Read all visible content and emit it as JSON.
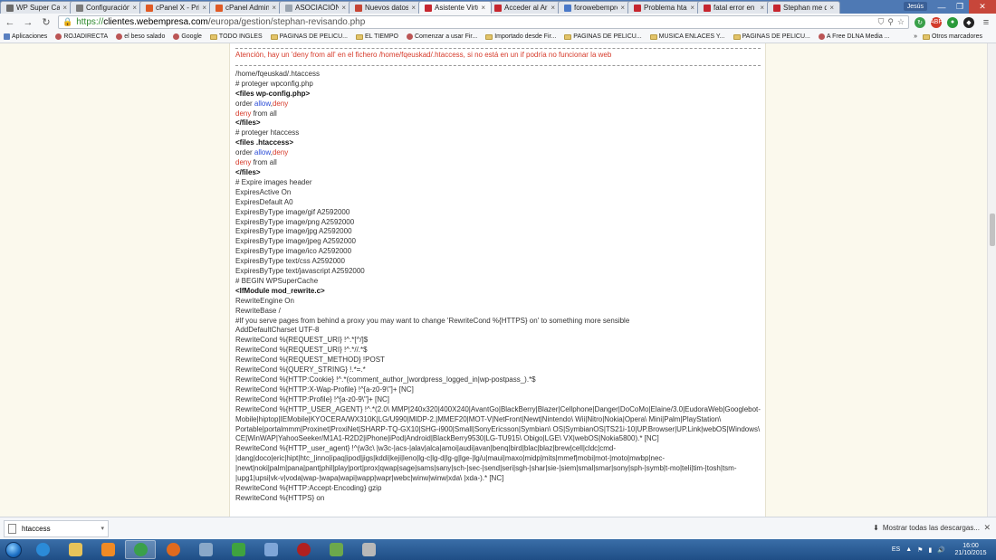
{
  "browser": {
    "tabs": [
      {
        "title": "WP Super Cache",
        "color": "#6b6b6b",
        "active": false
      },
      {
        "title": "Configuración",
        "color": "#7b7b7b",
        "active": false
      },
      {
        "title": "cPanel X - Princ",
        "color": "#e05a25",
        "active": false
      },
      {
        "title": "cPanel Administ",
        "color": "#e05a25",
        "active": false
      },
      {
        "title": "ASOCIACIÓN D.",
        "color": "#9aa4b0",
        "active": false
      },
      {
        "title": "Nuevos datos de",
        "color": "#c64534",
        "active": false
      },
      {
        "title": "Asistente Virtual",
        "color": "#c6262e",
        "active": true
      },
      {
        "title": "Acceder al Area",
        "color": "#c6262e",
        "active": false
      },
      {
        "title": "forowebempresa",
        "color": "#4a79c8",
        "active": false
      },
      {
        "title": "Problema htacce",
        "color": "#c6262e",
        "active": false
      },
      {
        "title": "fatal error en la",
        "color": "#c6262e",
        "active": false
      },
      {
        "title": "Stephan me da e",
        "color": "#c6262e",
        "active": false
      }
    ],
    "user_badge": "Jesús",
    "url_scheme": "https://",
    "url_host": "clientes.webempresa.com",
    "url_path": "/europa/gestion/stephan-revisando.php",
    "bookmarks": [
      {
        "label": "Aplicaciones",
        "kind": "apps"
      },
      {
        "label": "ROJADIRECTA",
        "kind": "site"
      },
      {
        "label": "el beso salado",
        "kind": "site"
      },
      {
        "label": "Google",
        "kind": "site"
      },
      {
        "label": "TODO INGLES",
        "kind": "folder"
      },
      {
        "label": "PAGINAS DE PELICU...",
        "kind": "folder"
      },
      {
        "label": "EL TIEMPO",
        "kind": "folder"
      },
      {
        "label": "Comenzar a usar Fir...",
        "kind": "site"
      },
      {
        "label": "Importado desde Fir...",
        "kind": "folder"
      },
      {
        "label": "PAGINAS DE PELICU...",
        "kind": "folder"
      },
      {
        "label": "MUSICA ENLACES Y...",
        "kind": "folder"
      },
      {
        "label": "PAGINAS DE PELICU...",
        "kind": "folder"
      },
      {
        "label": "A Free DLNA Media ...",
        "kind": "site"
      }
    ],
    "bookmarks_more": "»",
    "other_bookmarks": "Otros marcadores"
  },
  "page": {
    "warning": "Atención, hay un 'deny from all' en el fichero /home/fqeuskad/.htaccess, si no está en un if podría no funcionar la web",
    "lines": [
      [
        {
          "t": "/home/fqeuskad/.htaccess"
        }
      ],
      [
        {
          "t": "# proteger wpconfig.php"
        }
      ],
      [
        {
          "t": "<files wp-config.php>",
          "s": "b"
        }
      ],
      [
        {
          "t": "order "
        },
        {
          "t": "allow",
          "s": "blue"
        },
        {
          "t": ","
        },
        {
          "t": "deny",
          "s": "red"
        }
      ],
      [
        {
          "t": "deny",
          "s": "red"
        },
        {
          "t": " from all"
        }
      ],
      [
        {
          "t": "</files>",
          "s": "b"
        }
      ],
      [
        {
          "t": "# proteger htaccess"
        }
      ],
      [
        {
          "t": "<files .htaccess>",
          "s": "b"
        }
      ],
      [
        {
          "t": "order "
        },
        {
          "t": "allow",
          "s": "blue"
        },
        {
          "t": ","
        },
        {
          "t": "deny",
          "s": "red"
        }
      ],
      [
        {
          "t": "deny",
          "s": "red"
        },
        {
          "t": " from all"
        }
      ],
      [
        {
          "t": "</files>",
          "s": "b"
        }
      ],
      [
        {
          "t": "# Expire images header"
        }
      ],
      [
        {
          "t": "ExpiresActive On"
        }
      ],
      [
        {
          "t": "ExpiresDefault A0"
        }
      ],
      [
        {
          "t": "ExpiresByType image/gif A2592000"
        }
      ],
      [
        {
          "t": "ExpiresByType image/png A2592000"
        }
      ],
      [
        {
          "t": "ExpiresByType image/jpg A2592000"
        }
      ],
      [
        {
          "t": "ExpiresByType image/jpeg A2592000"
        }
      ],
      [
        {
          "t": "ExpiresByType image/ico A2592000"
        }
      ],
      [
        {
          "t": "ExpiresByType text/css A2592000"
        }
      ],
      [
        {
          "t": "ExpiresByType text/javascript A2592000"
        }
      ],
      [
        {
          "t": "# BEGIN WPSuperCache"
        }
      ],
      [
        {
          "t": "<IfModule mod_rewrite.c>",
          "s": "b"
        }
      ],
      [
        {
          "t": "RewriteEngine On"
        }
      ],
      [
        {
          "t": "RewriteBase /"
        }
      ],
      [
        {
          "t": "#If you serve pages from behind a proxy you may want to change 'RewriteCond %{HTTPS} on' to something more sensible"
        }
      ],
      [
        {
          "t": "AddDefaultCharset UTF-8"
        }
      ],
      [
        {
          "t": "RewriteCond %{REQUEST_URI} !^.*[^/]$"
        }
      ],
      [
        {
          "t": "RewriteCond %{REQUEST_URI} !^.*//.*$"
        }
      ],
      [
        {
          "t": "RewriteCond %{REQUEST_METHOD} !POST"
        }
      ],
      [
        {
          "t": "RewriteCond %{QUERY_STRING} !.*=.*"
        }
      ],
      [
        {
          "t": "RewriteCond %{HTTP:Cookie} !^.*(comment_author_|wordpress_logged_in|wp-postpass_).*$"
        }
      ],
      [
        {
          "t": "RewriteCond %{HTTP:X-Wap-Profile} !^[a-z0-9\\\"]+ [NC]"
        }
      ],
      [
        {
          "t": "RewriteCond %{HTTP:Profile} !^[a-z0-9\\\"]+ [NC]"
        }
      ],
      [
        {
          "t": "RewriteCond %{HTTP_USER_AGENT} !^.*(2.0\\ MMP|240x320|400X240|AvantGo|BlackBerry|Blazer|Cellphone|Danger|DoCoMo|Elaine/3.0|EudoraWeb|Googlebot-Mobile|hiptop|IEMobile|KYOCERA/WX310K|LG/U990|MIDP-2.|MMEF20|MOT-V|NetFront|Newt|Nintendo\\ Wii|Nitro|Nokia|Opera\\ Mini|Palm|PlayStation\\ Portable|portalmmm|Proxinet|ProxiNet|SHARP-TQ-GX10|SHG-i900|Small|SonyEricsson|Symbian\\ OS|SymbianOS|TS21i-10|UP.Browser|UP.Link|webOS|Windows\\ CE|WinWAP|YahooSeeker/M1A1-R2D2|iPhone|iPod|Android|BlackBerry9530|LG-TU915\\ Obigo|LGE\\ VX|webOS|Nokia5800).* [NC]"
        }
      ],
      [
        {
          "t": "RewriteCond %{HTTP_user_agent} !^(w3c\\ |w3c-|acs-|alav|alca|amoi|audi|avan|benq|bird|blac|blaz|brew|cell|cldc|cmd-|dang|doco|eric|hipt|htc_|inno|ipaq|ipod|jigs|kddi|keji|leno|lg-c|lg-d|lg-g|lge-|lg/u|maui|maxo|midp|mits|mmef|mobi|mot-|moto|mwbp|nec-|newt|noki|palm|pana|pant|phil|play|port|prox|qwap|sage|sams|sany|sch-|sec-|send|seri|sgh-|shar|sie-|siem|smal|smar|sony|sph-|symb|t-mo|teli|tim-|tosh|tsm-|upg1|upsi|vk-v|voda|wap-|wapa|wapi|wapp|wapr|webc|winw|winw|xda\\ |xda-).* [NC]"
        }
      ],
      [
        {
          "t": "RewriteCond %{HTTP:Accept-Encoding} gzip"
        }
      ],
      [
        {
          "t": "RewriteCond %{HTTPS} on"
        }
      ]
    ]
  },
  "download_shelf": {
    "file_name": "htaccess",
    "show_all": "Mostrar todas las descargas..."
  },
  "taskbar": {
    "apps": [
      {
        "name": "internet-explorer",
        "color": "#2b8bd8"
      },
      {
        "name": "file-explorer",
        "color": "#e7c35a"
      },
      {
        "name": "media-player",
        "color": "#f08a24"
      },
      {
        "name": "chrome",
        "color": "#3aa04a",
        "active": true
      },
      {
        "name": "firefox",
        "color": "#e06a1e"
      },
      {
        "name": "remote-desktop",
        "color": "#8aa8c8"
      },
      {
        "name": "utorrent",
        "color": "#3fa33f"
      },
      {
        "name": "notepad",
        "color": "#7fa6d8"
      },
      {
        "name": "spider-app",
        "color": "#b02020"
      },
      {
        "name": "spreadsheet",
        "color": "#6ca84c"
      },
      {
        "name": "tools",
        "color": "#b8b8b8"
      }
    ],
    "language": "ES",
    "time": "16:00",
    "date": "21/10/2015"
  }
}
